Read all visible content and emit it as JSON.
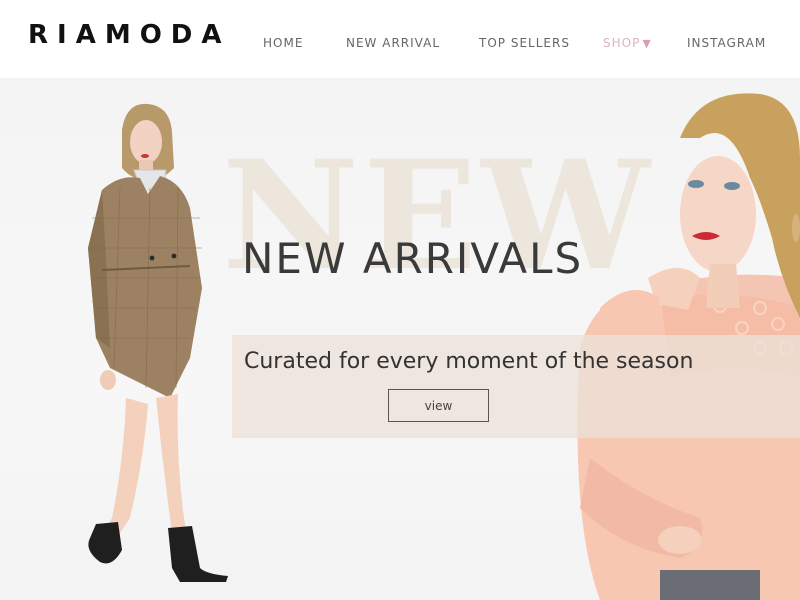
{
  "header": {
    "logo": "RIAMODA",
    "nav": {
      "home": "HOME",
      "new_arrival": "NEW ARRIVAL",
      "top_sellers": "TOP SELLERS",
      "shop": "SHOP",
      "instagram": "INSTAGRAM"
    },
    "active_item": "shop",
    "active_color": "#d9b4c0"
  },
  "hero": {
    "watermark": "NEW",
    "title": "NEW ARRIVALS",
    "caption": "Curated for every moment of the season",
    "button_label": "view"
  }
}
